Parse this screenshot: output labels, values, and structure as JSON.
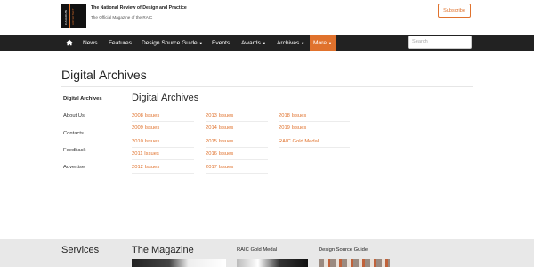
{
  "header": {
    "logo_lines": [
      "CANADIAN",
      "ARCHITECT"
    ],
    "tagline": "The National Review of Design and Practice",
    "sub_tagline": "The Official Magazine of the RAIC",
    "subscribe_label": "Subscribe"
  },
  "nav": {
    "items": [
      {
        "label": "News"
      },
      {
        "label": "Features"
      },
      {
        "label": "Design Source Guide",
        "dropdown": true
      },
      {
        "label": "Events"
      },
      {
        "label": "Awards",
        "dropdown": true
      },
      {
        "label": "Archives",
        "dropdown": true
      },
      {
        "label": "More",
        "dropdown": true
      }
    ],
    "search_placeholder": "Search",
    "colors": {
      "bar": "#222222",
      "accent": "#e0722d"
    }
  },
  "page": {
    "title": "Digital Archives"
  },
  "sidebar": {
    "items": [
      {
        "label": "Digital Archives"
      },
      {
        "label": "About Us"
      },
      {
        "label": "Contacts"
      },
      {
        "label": "Feedback"
      },
      {
        "label": "Advertise"
      }
    ]
  },
  "archives": {
    "title": "Digital Archives",
    "columns": [
      [
        "2008 Issues",
        "2009 Issues",
        "2010 Issues",
        "2011 Issues",
        "2012 Issues"
      ],
      [
        "2013 Issues",
        "2014 Issues",
        "2015 Issues",
        "2016 Issues",
        "2017 Issues"
      ],
      [
        "2018 Issues",
        "2019 Issues",
        "RAIC Gold Medal"
      ]
    ]
  },
  "footer": {
    "services": "Services",
    "magazine": "The Magazine",
    "gold_medal": "RAIC Gold Medal",
    "design_source": "Design Source Guide"
  }
}
